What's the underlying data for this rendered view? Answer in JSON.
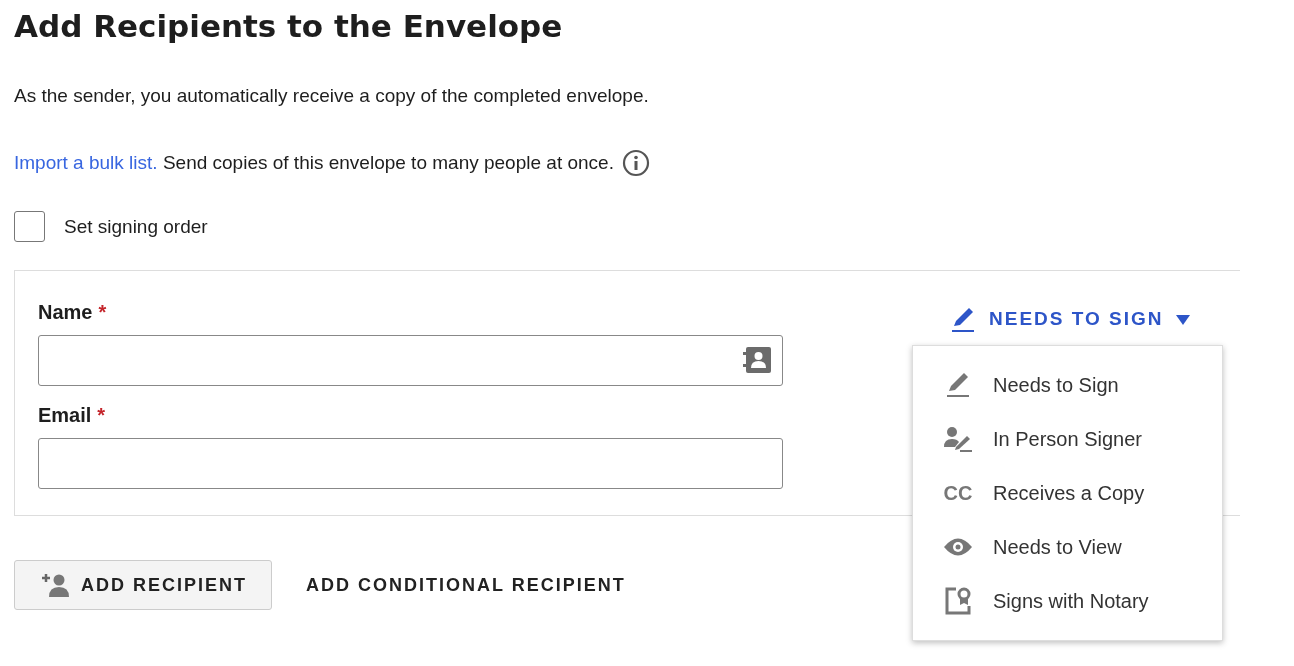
{
  "title": "Add Recipients to the Envelope",
  "intro": "As the sender, you automatically receive a copy of the completed envelope.",
  "bulk": {
    "link": "Import a bulk list.",
    "text": "Send copies of this envelope to many people at once."
  },
  "signing_order": {
    "label": "Set signing order",
    "checked": false
  },
  "recipient": {
    "fields": [
      {
        "label": "Name",
        "required_mark": "*",
        "kind": "contacts"
      },
      {
        "label": "Email",
        "required_mark": "*",
        "kind": "plain"
      }
    ],
    "role": {
      "label": "NEEDS TO SIGN",
      "expanded": true
    },
    "role_menu": [
      {
        "kind": "sign",
        "label": "Needs to Sign"
      },
      {
        "kind": "in_person",
        "label": "In Person Signer"
      },
      {
        "kind": "cc",
        "icon_text": "CC",
        "label": "Receives a Copy"
      },
      {
        "kind": "view",
        "label": "Needs to View"
      },
      {
        "kind": "notary",
        "label": "Signs with Notary"
      }
    ]
  },
  "actions": [
    {
      "kind": "add",
      "label": "ADD RECIPIENT"
    },
    {
      "kind": "link",
      "label": "ADD CONDITIONAL RECIPIENT"
    }
  ]
}
